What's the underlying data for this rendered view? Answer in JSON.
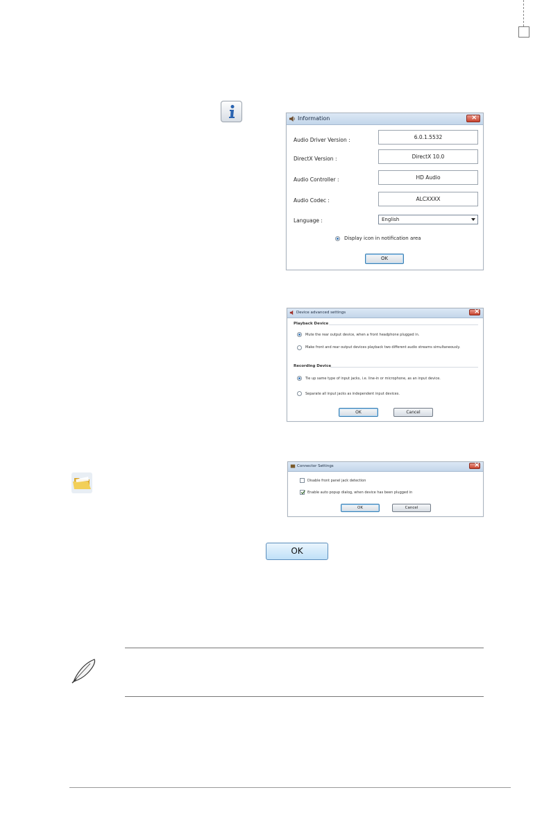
{
  "info_window": {
    "title": "Information",
    "rows": [
      {
        "label": "Audio Driver Version :",
        "value": "6.0.1.5532"
      },
      {
        "label": "DirectX Version :",
        "value": "DirectX 10.0"
      },
      {
        "label": "Audio Controller :",
        "value": "HD Audio"
      },
      {
        "label": "Audio Codec :",
        "value": "ALCXXXX"
      }
    ],
    "language_label": "Language :",
    "language_value": "English",
    "notification_option": "Display icon in notification area",
    "ok_label": "OK"
  },
  "device_window": {
    "title": "Device advanced settings",
    "playback_heading": "Playback Device",
    "playback_options": [
      "Mute the rear output device, when a front headphone plugged in.",
      "Make front and rear output devices playback two different audio streams simultaneously."
    ],
    "recording_heading": "Recording Device",
    "recording_options": [
      "Tie up same type of input jacks, i.e. line-in or microphone, as an input device.",
      "Separate all input jacks as independent input devices."
    ],
    "ok_label": "OK",
    "cancel_label": "Cancel"
  },
  "connector_window": {
    "title": "Connector Settings",
    "options": [
      "Disable front panel jack detection",
      "Enable auto popup dialog, when device has been plugged in"
    ],
    "ok_label": "OK",
    "cancel_label": "Cancel"
  },
  "ok_button_label": "OK",
  "colors": {
    "accent": "#3a78b8",
    "close": "#c9432e"
  }
}
